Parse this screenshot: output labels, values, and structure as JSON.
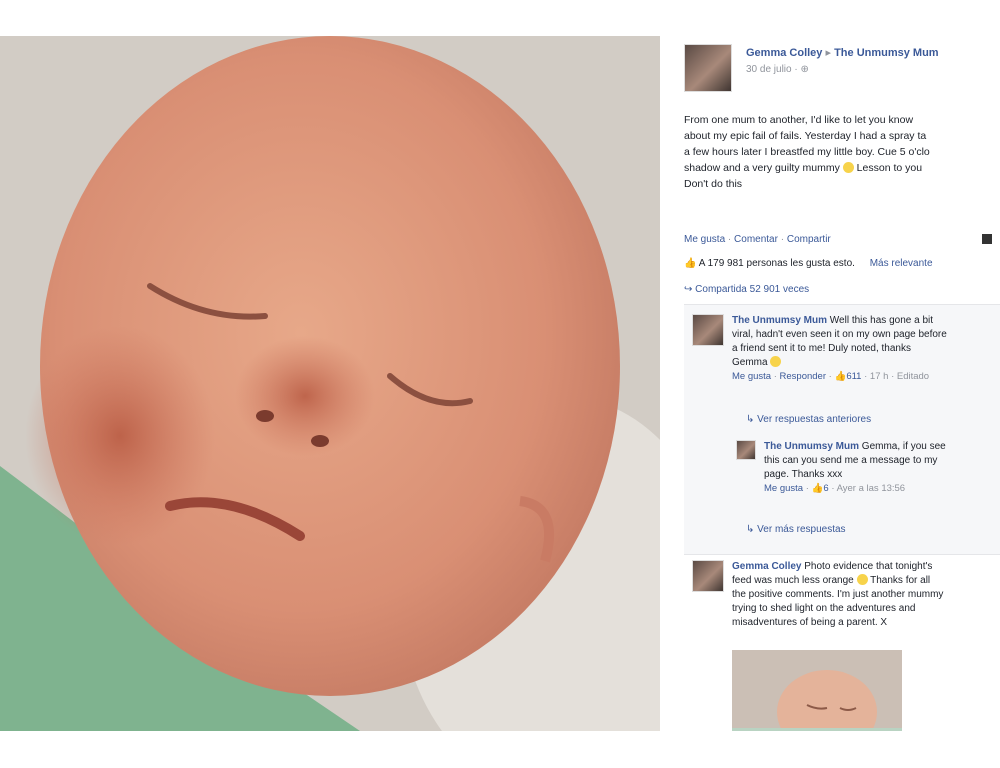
{
  "post": {
    "author": "Gemma Colley",
    "arrow": "▸",
    "page": "The Unmumsy Mum",
    "date": "30 de julio ·",
    "lines": [
      "From one mum to another, I'd like to let you know",
      "about my epic fail of fails. Yesterday I had a spray ta",
      "a few hours later I breastfed my little boy. Cue 5 o'clo",
      "shadow and a very guilty mummy",
      "Lesson to you",
      "Don't do this"
    ]
  },
  "actions": {
    "like": "Me gusta",
    "dot1": "·",
    "comment": "Comentar",
    "dot2": "·",
    "share": "Compartir"
  },
  "stats": {
    "likes": "A 179 981 personas les gusta esto.",
    "relevance": "Más relevante",
    "shared": "Compartida 52 901 veces"
  },
  "comments": [
    {
      "author": "The Unmumsy Mum",
      "lines": [
        "Well this has gone a bit",
        "viral, hadn't even seen it on my own page before",
        "a friend sent it to me! Duly noted, thanks",
        "Gemma"
      ],
      "like": "Me gusta",
      "reply": "Responder",
      "count": "611",
      "time": "17 h",
      "edited": "Editado"
    },
    {
      "author": "The Unmumsy Mum",
      "lines": [
        "Gemma, if you see",
        "this can you send me a message to my",
        "page. Thanks xxx"
      ],
      "like": "Me gusta",
      "count": "6",
      "time": "Ayer a las 13:56"
    },
    {
      "author": "Gemma Colley",
      "lines": [
        "Photo evidence that tonight's",
        "feed was much less orange",
        "Thanks for all",
        "the positive comments. I'm just another mummy",
        "trying to shed light on the adventures and",
        "misadventures of being a parent. X"
      ]
    }
  ],
  "replies": {
    "previous": "Ver respuestas anteriores",
    "more": "Ver más respuestas"
  },
  "colors": {
    "link": "#3b5998",
    "muted": "#90949c"
  }
}
